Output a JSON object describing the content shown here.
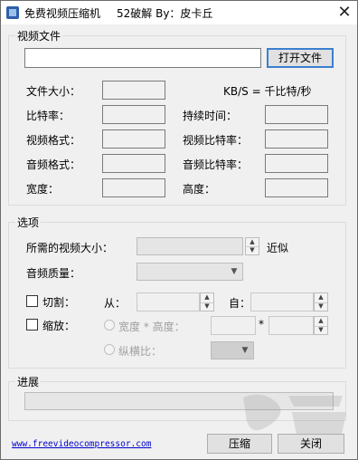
{
  "window": {
    "title": "免费视频压缩机",
    "subtitle": "52破解 By：皮卡丘",
    "close_label": "✕"
  },
  "video_file": {
    "group_label": "视频文件",
    "path_value": "",
    "open_button": "打开文件",
    "kbs_note": "KB/S = 千比特/秒",
    "labels": {
      "file_size": "文件大小：",
      "bitrate": "比特率：",
      "duration": "持续时间：",
      "video_format": "视频格式：",
      "video_bitrate": "视频比特率：",
      "audio_format": "音频格式：",
      "audio_bitrate": "音频比特率：",
      "width": "宽度：",
      "height": "高度："
    }
  },
  "options": {
    "group_label": "选项",
    "target_size_label": "所需的视频大小：",
    "approx_label": "近似",
    "audio_quality_label": "音频质量：",
    "cut_label": "切割：",
    "from_label": "从：",
    "to_label": "自：",
    "scale_label": "缩放：",
    "wh_label": "宽度 * 高度：",
    "times_sign": "*",
    "aspect_label": "纵横比："
  },
  "progress": {
    "group_label": "进展",
    "value": 0
  },
  "footer": {
    "link_text": "www.freevideocompressor.com",
    "compress_button": "压缩",
    "close_button": "关闭"
  }
}
